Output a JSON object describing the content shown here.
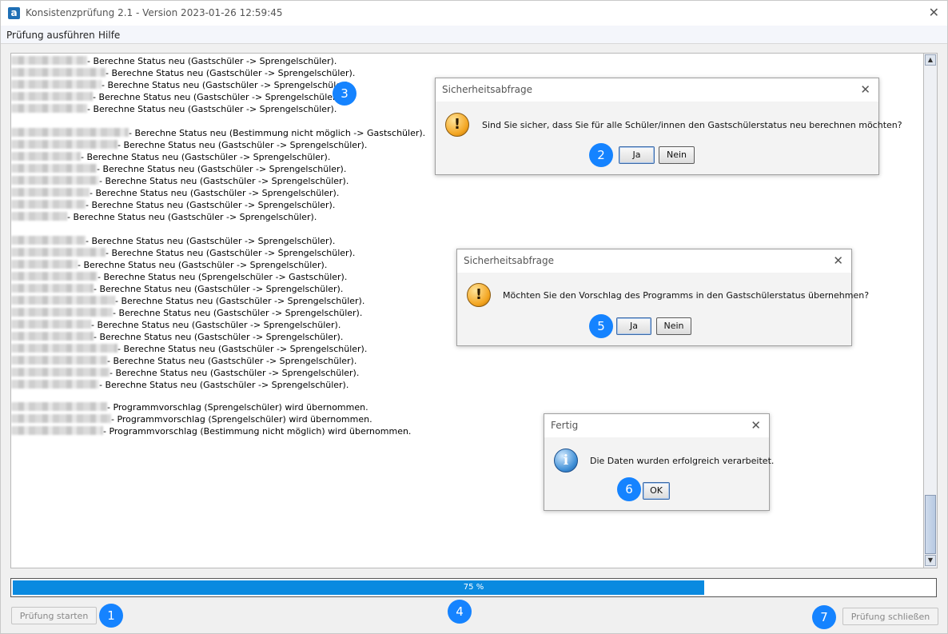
{
  "window": {
    "title": "Konsistenzprüfung 2.1 - Version 2023-01-26 12:59:45",
    "app_icon_letter": "a",
    "close_glyph": "✕"
  },
  "menu": [
    {
      "label": "Prüfung ausführen"
    },
    {
      "label": "Hilfe"
    }
  ],
  "log": {
    "lines": [
      {
        "text": "- Berechne Status neu (Gastschüler -> Sprengelschüler)."
      },
      {
        "text": "- Berechne Status neu (Gastschüler -> Sprengelschüler)."
      },
      {
        "text": "- Berechne Status neu (Gastschüler -> Sprengelschüler)."
      },
      {
        "text": "- Berechne Status neu (Gastschüler -> Sprengelschüler)."
      },
      {
        "text": "- Berechne Status neu (Gastschüler -> Sprengelschüler)."
      },
      {
        "text": "- Berechne Status neu (Bestimmung nicht möglich -> Gastschüler)."
      },
      {
        "text": "- Berechne Status neu (Gastschüler -> Sprengelschüler)."
      },
      {
        "text": "- Berechne Status neu (Gastschüler -> Sprengelschüler)."
      },
      {
        "text": "- Berechne Status neu (Gastschüler -> Sprengelschüler)."
      },
      {
        "text": "- Berechne Status neu (Gastschüler -> Sprengelschüler)."
      },
      {
        "text": "- Berechne Status neu (Gastschüler -> Sprengelschüler)."
      },
      {
        "text": "- Berechne Status neu (Gastschüler -> Sprengelschüler)."
      },
      {
        "text": "- Berechne Status neu (Gastschüler -> Sprengelschüler)."
      },
      {
        "text": "- Berechne Status neu (Gastschüler -> Sprengelschüler)."
      },
      {
        "text": "- Berechne Status neu (Gastschüler -> Sprengelschüler)."
      },
      {
        "text": "- Berechne Status neu (Gastschüler -> Sprengelschüler)."
      },
      {
        "text": "- Berechne Status neu (Sprengelschüler -> Gastschüler)."
      },
      {
        "text": "- Berechne Status neu (Gastschüler -> Sprengelschüler)."
      },
      {
        "text": "- Berechne Status neu (Gastschüler -> Sprengelschüler)."
      },
      {
        "text": "- Berechne Status neu (Gastschüler -> Sprengelschüler)."
      },
      {
        "text": "- Berechne Status neu (Gastschüler -> Sprengelschüler)."
      },
      {
        "text": "- Berechne Status neu (Gastschüler -> Sprengelschüler)."
      },
      {
        "text": "- Berechne Status neu (Gastschüler -> Sprengelschüler)."
      },
      {
        "text": "- Berechne Status neu (Gastschüler -> Sprengelschüler)."
      },
      {
        "text": "- Berechne Status neu (Gastschüler -> Sprengelschüler)."
      },
      {
        "text": "- Berechne Status neu (Gastschüler -> Sprengelschüler)."
      },
      {
        "text": "- Programmvorschlag (Sprengelschüler) wird übernommen."
      },
      {
        "text": "- Programmvorschlag (Sprengelschüler) wird übernommen."
      },
      {
        "text": "- Programmvorschlag (Bestimmung nicht möglich) wird übernommen."
      }
    ]
  },
  "progress": {
    "percent": 75,
    "label": "75 %"
  },
  "buttons": {
    "start": "Prüfung starten",
    "close": "Prüfung schließen"
  },
  "badges": [
    "1",
    "2",
    "3",
    "4",
    "5",
    "6",
    "7"
  ],
  "dialogs": {
    "confirm1": {
      "title": "Sicherheitsabfrage",
      "message": "Sind Sie sicher, dass Sie für alle Schüler/innen den Gastschülerstatus neu berechnen möchten?",
      "yes": "Ja",
      "no": "Nein",
      "icon": "warning-icon"
    },
    "confirm2": {
      "title": "Sicherheitsabfrage",
      "message": "Möchten Sie den Vorschlag des Programms in den Gastschülerstatus übernehmen?",
      "yes": "Ja",
      "no": "Nein",
      "icon": "warning-icon"
    },
    "done": {
      "title": "Fertig",
      "message": "Die Daten wurden erfolgreich verarbeitet.",
      "ok": "OK",
      "icon": "info-icon"
    }
  },
  "colors": {
    "accent": "#0a8ae0",
    "badge": "#1583ff"
  }
}
